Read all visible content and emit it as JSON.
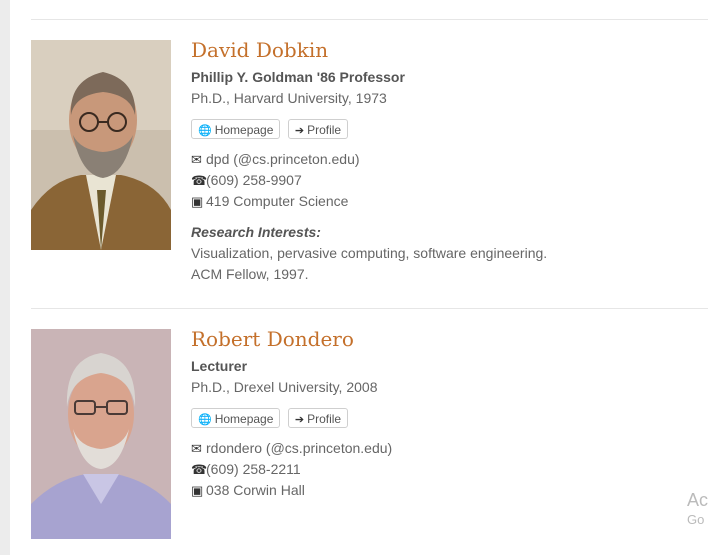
{
  "people": [
    {
      "name": "David Dobkin",
      "title": "Phillip Y. Goldman '86 Professor",
      "degree": "Ph.D., Harvard University, 1973",
      "homepage_label": "Homepage",
      "profile_label": "Profile",
      "email": "dpd  (@cs.princeton.edu)",
      "phone": "(609) 258-9907",
      "office": "419 Computer Science",
      "research_heading": "Research Interests:",
      "research_line1": "Visualization, pervasive computing, software engineering.",
      "research_line2": "ACM Fellow, 1997."
    },
    {
      "name": "Robert Dondero",
      "title": "Lecturer",
      "degree": "Ph.D., Drexel University, 2008",
      "homepage_label": "Homepage",
      "profile_label": "Profile",
      "email": "rdondero  (@cs.princeton.edu)",
      "phone": "(609) 258-2211",
      "office": "038 Corwin Hall"
    }
  ],
  "watermark": {
    "line1": "Ac",
    "line2": "Go"
  },
  "icons": {
    "homepage": "globe-icon",
    "profile": "arrow-right-icon",
    "email": "envelope-icon",
    "phone": "phone-icon",
    "office": "briefcase-icon"
  }
}
